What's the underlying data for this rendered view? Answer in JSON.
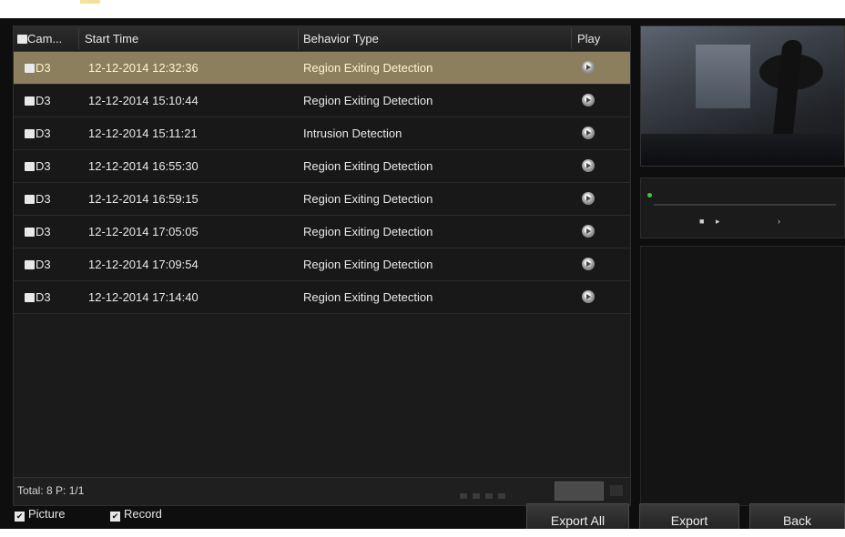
{
  "table": {
    "headers": {
      "camera": "Cam...",
      "start_time": "Start Time",
      "behavior_type": "Behavior Type",
      "play": "Play"
    },
    "rows": [
      {
        "camera": "D3",
        "start_time": "12-12-2014 12:32:36",
        "behavior": "Region Exiting Detection",
        "selected": true
      },
      {
        "camera": "D3",
        "start_time": "12-12-2014 15:10:44",
        "behavior": "Region Exiting Detection",
        "selected": false
      },
      {
        "camera": "D3",
        "start_time": "12-12-2014 15:11:21",
        "behavior": "Intrusion Detection",
        "selected": false
      },
      {
        "camera": "D3",
        "start_time": "12-12-2014 16:55:30",
        "behavior": "Region Exiting Detection",
        "selected": false
      },
      {
        "camera": "D3",
        "start_time": "12-12-2014 16:59:15",
        "behavior": "Region Exiting Detection",
        "selected": false
      },
      {
        "camera": "D3",
        "start_time": "12-12-2014 17:05:05",
        "behavior": "Region Exiting Detection",
        "selected": false
      },
      {
        "camera": "D3",
        "start_time": "12-12-2014 17:09:54",
        "behavior": "Region Exiting Detection",
        "selected": false
      },
      {
        "camera": "D3",
        "start_time": "12-12-2014 17:14:40",
        "behavior": "Region Exiting Detection",
        "selected": false
      }
    ],
    "footer": {
      "total_label": "Total: 8  P: 1/1"
    }
  },
  "options": {
    "picture": {
      "label": "Picture",
      "checked": true
    },
    "record": {
      "label": "Record",
      "checked": true
    }
  },
  "buttons": {
    "export_all": "Export All",
    "export": "Export",
    "back": "Back"
  },
  "icons": {
    "play": "play-circle-icon",
    "checkbox": "checkbox-icon",
    "stop": "stop-icon",
    "next": "next-icon"
  },
  "colors": {
    "selected_row": "#8b7f5e",
    "background": "#0e0e0e",
    "panel": "#1b1b1b",
    "status_dot": "#3ec63e"
  }
}
